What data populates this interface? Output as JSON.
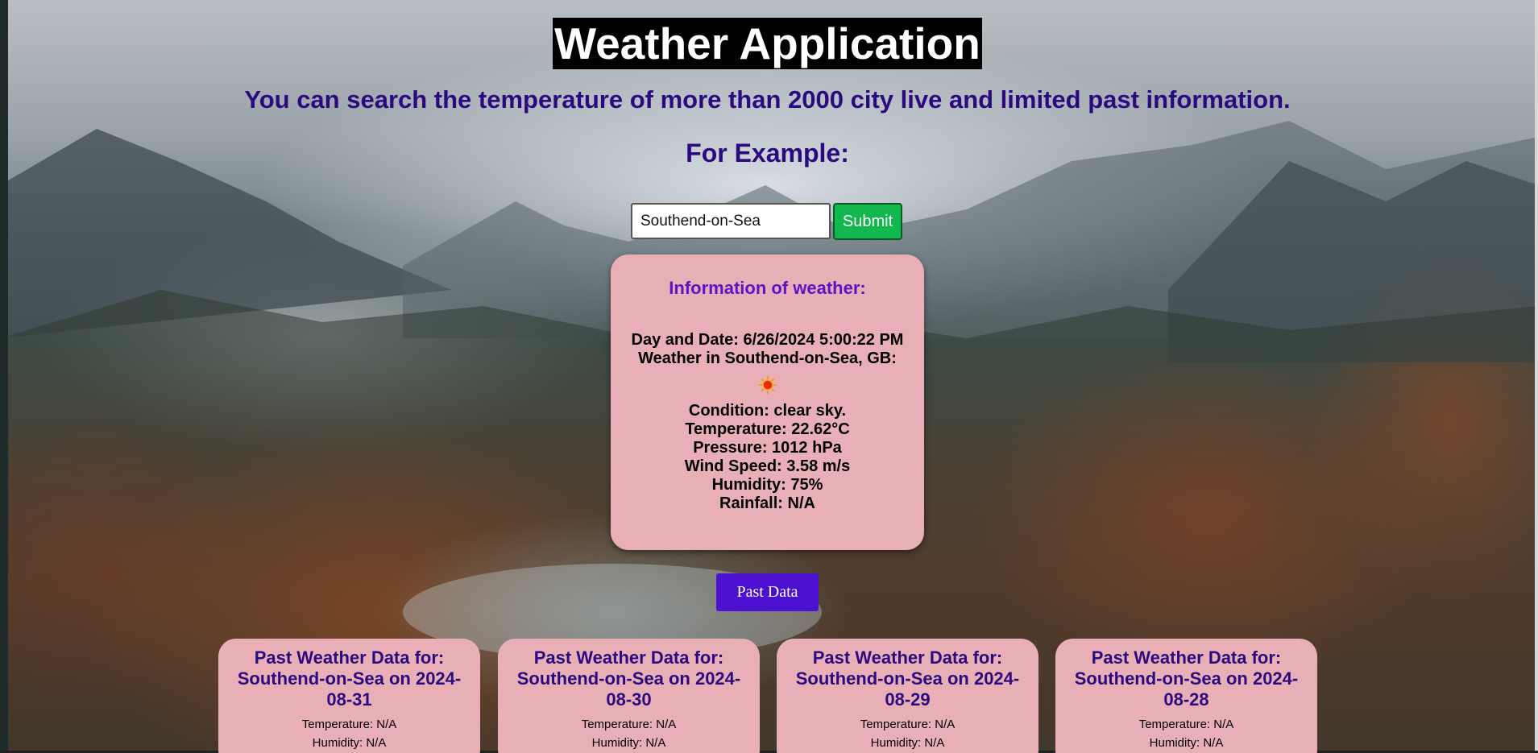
{
  "header": {
    "title": "Weather Application",
    "subtitle": "You can search the temperature of more than 2000 city live and limited past information.",
    "example_label": "For Example:"
  },
  "search": {
    "value": "Southend-on-Sea",
    "submit_label": "Submit"
  },
  "current": {
    "heading": "Information of weather:",
    "datetime": "Day and Date: 6/26/2024 5:00:22 PM",
    "location": "Weather in Southend-on-Sea, GB:",
    "icon": "sun-icon",
    "condition": "Condition: clear sky.",
    "temperature": "Temperature: 22.62°C",
    "pressure": "Pressure: 1012 hPa",
    "wind": "Wind Speed: 3.58 m/s",
    "humidity": "Humidity: 75%",
    "rainfall": "Rainfall: N/A"
  },
  "past_button_label": "Past Data",
  "past": [
    {
      "title": "Past Weather Data for: Southend-on-Sea on 2024-08-31",
      "temperature": "Temperature: N/A",
      "humidity": "Humidity: N/A"
    },
    {
      "title": "Past Weather Data for: Southend-on-Sea on 2024-08-30",
      "temperature": "Temperature: N/A",
      "humidity": "Humidity: N/A"
    },
    {
      "title": "Past Weather Data for: Southend-on-Sea on 2024-08-29",
      "temperature": "Temperature: N/A",
      "humidity": "Humidity: N/A"
    },
    {
      "title": "Past Weather Data for: Southend-on-Sea on 2024-08-28",
      "temperature": "Temperature: N/A",
      "humidity": "Humidity: N/A"
    }
  ],
  "colors": {
    "heading_text": "#2b0a80",
    "card_bg": "#e8b0b6",
    "submit_bg": "#12b84e",
    "past_button_bg": "#4b10d0"
  }
}
